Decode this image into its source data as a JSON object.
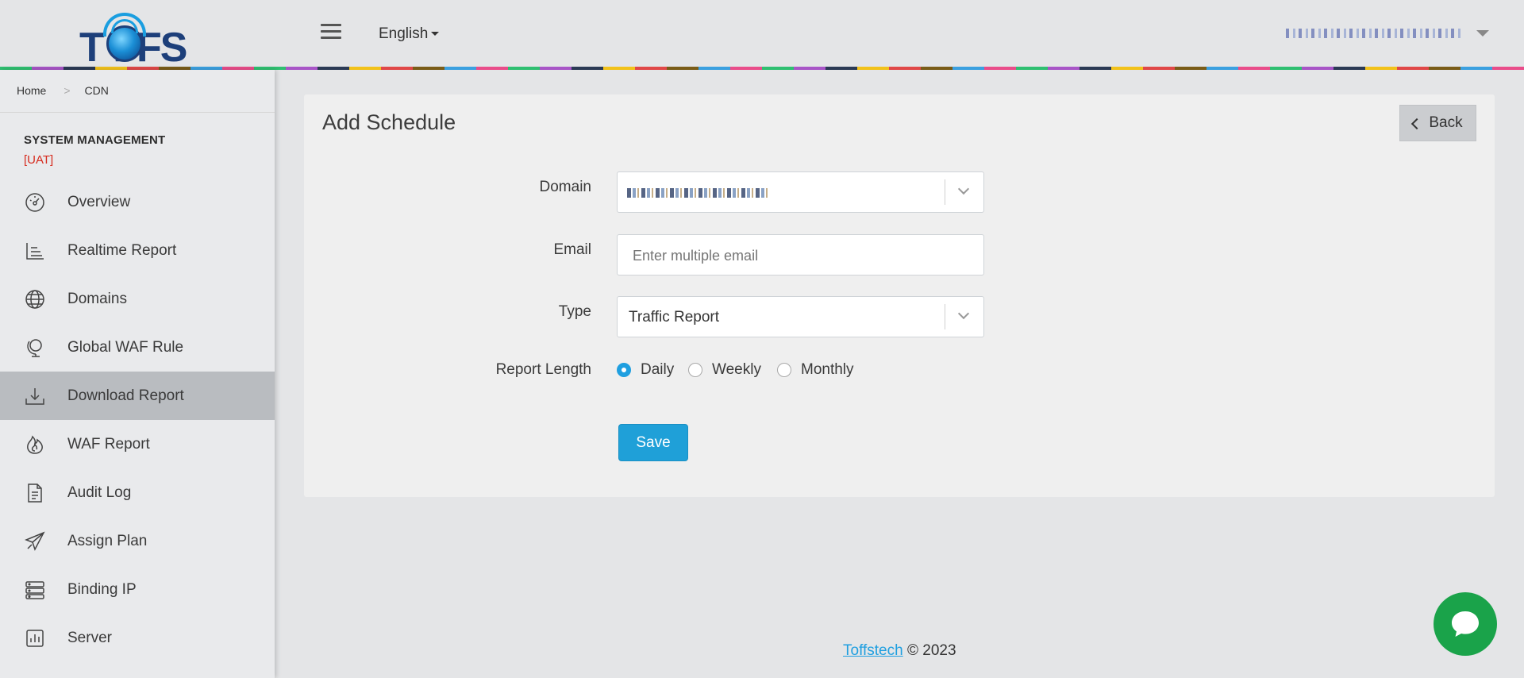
{
  "header": {
    "logo_text": "T FFS",
    "language": "English"
  },
  "breadcrumb": {
    "home": "Home",
    "current": "CDN"
  },
  "sidebar": {
    "section_title": "SYSTEM MANAGEMENT",
    "environment_tag": "[UAT]",
    "items": [
      {
        "label": "Overview",
        "icon": "speedometer-icon"
      },
      {
        "label": "Realtime Report",
        "icon": "bar-list-icon"
      },
      {
        "label": "Domains",
        "icon": "globe-icon"
      },
      {
        "label": "Global WAF Rule",
        "icon": "globe-stand-icon"
      },
      {
        "label": "Download Report",
        "icon": "download-icon",
        "active": true
      },
      {
        "label": "WAF Report",
        "icon": "fire-icon"
      },
      {
        "label": "Audit Log",
        "icon": "document-icon"
      },
      {
        "label": "Assign Plan",
        "icon": "paper-plane-icon"
      },
      {
        "label": "Binding IP",
        "icon": "server-stack-icon"
      },
      {
        "label": "Server",
        "icon": "chart-box-icon"
      }
    ]
  },
  "page": {
    "title": "Add Schedule",
    "back_label": "Back",
    "form": {
      "domain_label": "Domain",
      "email_label": "Email",
      "email_placeholder": "Enter multiple email",
      "type_label": "Type",
      "type_value": "Traffic Report",
      "report_length_label": "Report Length",
      "report_length_options": [
        "Daily",
        "Weekly",
        "Monthly"
      ],
      "report_length_selected": "Daily",
      "save_label": "Save"
    }
  },
  "footer": {
    "link": "Toffstech",
    "text": "© 2023"
  },
  "colors": {
    "accent": "#1f9fe0",
    "uat": "#d62b1e",
    "chat": "#1aa34a"
  }
}
